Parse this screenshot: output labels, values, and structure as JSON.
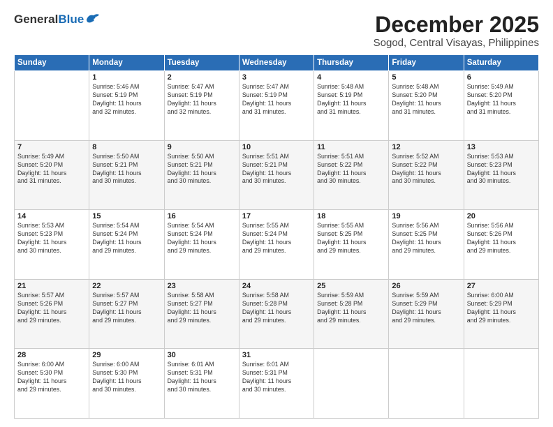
{
  "logo": {
    "general": "General",
    "blue": "Blue"
  },
  "title": "December 2025",
  "location": "Sogod, Central Visayas, Philippines",
  "headers": [
    "Sunday",
    "Monday",
    "Tuesday",
    "Wednesday",
    "Thursday",
    "Friday",
    "Saturday"
  ],
  "weeks": [
    [
      {
        "day": "",
        "info": ""
      },
      {
        "day": "1",
        "info": "Sunrise: 5:46 AM\nSunset: 5:19 PM\nDaylight: 11 hours\nand 32 minutes."
      },
      {
        "day": "2",
        "info": "Sunrise: 5:47 AM\nSunset: 5:19 PM\nDaylight: 11 hours\nand 32 minutes."
      },
      {
        "day": "3",
        "info": "Sunrise: 5:47 AM\nSunset: 5:19 PM\nDaylight: 11 hours\nand 31 minutes."
      },
      {
        "day": "4",
        "info": "Sunrise: 5:48 AM\nSunset: 5:19 PM\nDaylight: 11 hours\nand 31 minutes."
      },
      {
        "day": "5",
        "info": "Sunrise: 5:48 AM\nSunset: 5:20 PM\nDaylight: 11 hours\nand 31 minutes."
      },
      {
        "day": "6",
        "info": "Sunrise: 5:49 AM\nSunset: 5:20 PM\nDaylight: 11 hours\nand 31 minutes."
      }
    ],
    [
      {
        "day": "7",
        "info": "Sunrise: 5:49 AM\nSunset: 5:20 PM\nDaylight: 11 hours\nand 31 minutes."
      },
      {
        "day": "8",
        "info": "Sunrise: 5:50 AM\nSunset: 5:21 PM\nDaylight: 11 hours\nand 30 minutes."
      },
      {
        "day": "9",
        "info": "Sunrise: 5:50 AM\nSunset: 5:21 PM\nDaylight: 11 hours\nand 30 minutes."
      },
      {
        "day": "10",
        "info": "Sunrise: 5:51 AM\nSunset: 5:21 PM\nDaylight: 11 hours\nand 30 minutes."
      },
      {
        "day": "11",
        "info": "Sunrise: 5:51 AM\nSunset: 5:22 PM\nDaylight: 11 hours\nand 30 minutes."
      },
      {
        "day": "12",
        "info": "Sunrise: 5:52 AM\nSunset: 5:22 PM\nDaylight: 11 hours\nand 30 minutes."
      },
      {
        "day": "13",
        "info": "Sunrise: 5:53 AM\nSunset: 5:23 PM\nDaylight: 11 hours\nand 30 minutes."
      }
    ],
    [
      {
        "day": "14",
        "info": "Sunrise: 5:53 AM\nSunset: 5:23 PM\nDaylight: 11 hours\nand 30 minutes."
      },
      {
        "day": "15",
        "info": "Sunrise: 5:54 AM\nSunset: 5:24 PM\nDaylight: 11 hours\nand 29 minutes."
      },
      {
        "day": "16",
        "info": "Sunrise: 5:54 AM\nSunset: 5:24 PM\nDaylight: 11 hours\nand 29 minutes."
      },
      {
        "day": "17",
        "info": "Sunrise: 5:55 AM\nSunset: 5:24 PM\nDaylight: 11 hours\nand 29 minutes."
      },
      {
        "day": "18",
        "info": "Sunrise: 5:55 AM\nSunset: 5:25 PM\nDaylight: 11 hours\nand 29 minutes."
      },
      {
        "day": "19",
        "info": "Sunrise: 5:56 AM\nSunset: 5:25 PM\nDaylight: 11 hours\nand 29 minutes."
      },
      {
        "day": "20",
        "info": "Sunrise: 5:56 AM\nSunset: 5:26 PM\nDaylight: 11 hours\nand 29 minutes."
      }
    ],
    [
      {
        "day": "21",
        "info": "Sunrise: 5:57 AM\nSunset: 5:26 PM\nDaylight: 11 hours\nand 29 minutes."
      },
      {
        "day": "22",
        "info": "Sunrise: 5:57 AM\nSunset: 5:27 PM\nDaylight: 11 hours\nand 29 minutes."
      },
      {
        "day": "23",
        "info": "Sunrise: 5:58 AM\nSunset: 5:27 PM\nDaylight: 11 hours\nand 29 minutes."
      },
      {
        "day": "24",
        "info": "Sunrise: 5:58 AM\nSunset: 5:28 PM\nDaylight: 11 hours\nand 29 minutes."
      },
      {
        "day": "25",
        "info": "Sunrise: 5:59 AM\nSunset: 5:28 PM\nDaylight: 11 hours\nand 29 minutes."
      },
      {
        "day": "26",
        "info": "Sunrise: 5:59 AM\nSunset: 5:29 PM\nDaylight: 11 hours\nand 29 minutes."
      },
      {
        "day": "27",
        "info": "Sunrise: 6:00 AM\nSunset: 5:29 PM\nDaylight: 11 hours\nand 29 minutes."
      }
    ],
    [
      {
        "day": "28",
        "info": "Sunrise: 6:00 AM\nSunset: 5:30 PM\nDaylight: 11 hours\nand 29 minutes."
      },
      {
        "day": "29",
        "info": "Sunrise: 6:00 AM\nSunset: 5:30 PM\nDaylight: 11 hours\nand 30 minutes."
      },
      {
        "day": "30",
        "info": "Sunrise: 6:01 AM\nSunset: 5:31 PM\nDaylight: 11 hours\nand 30 minutes."
      },
      {
        "day": "31",
        "info": "Sunrise: 6:01 AM\nSunset: 5:31 PM\nDaylight: 11 hours\nand 30 minutes."
      },
      {
        "day": "",
        "info": ""
      },
      {
        "day": "",
        "info": ""
      },
      {
        "day": "",
        "info": ""
      }
    ]
  ]
}
